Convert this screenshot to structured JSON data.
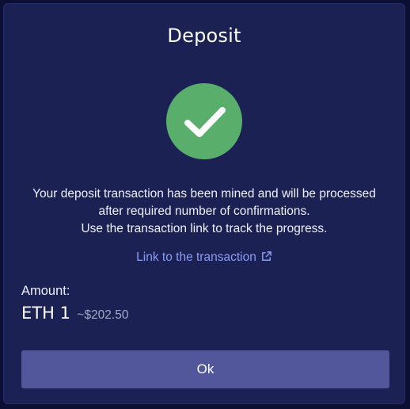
{
  "dialog": {
    "title": "Deposit",
    "status_icon": "checkmark-icon",
    "message_lines": [
      "Your deposit transaction has been mined and will be processed",
      "after required number of confirmations.",
      "Use the transaction link to track the progress."
    ],
    "link_label": "Link to the transaction",
    "link_icon": "external-link-icon",
    "amount_label": "Amount:",
    "amount_value": "ETH 1",
    "amount_fiat": "~$202.50",
    "ok_label": "Ok"
  },
  "colors": {
    "page_background": "#0b0f33",
    "dialog_background": "#1c2154",
    "success_green": "#5aae6c",
    "link": "#8c9cf2",
    "button": "#52579b"
  }
}
